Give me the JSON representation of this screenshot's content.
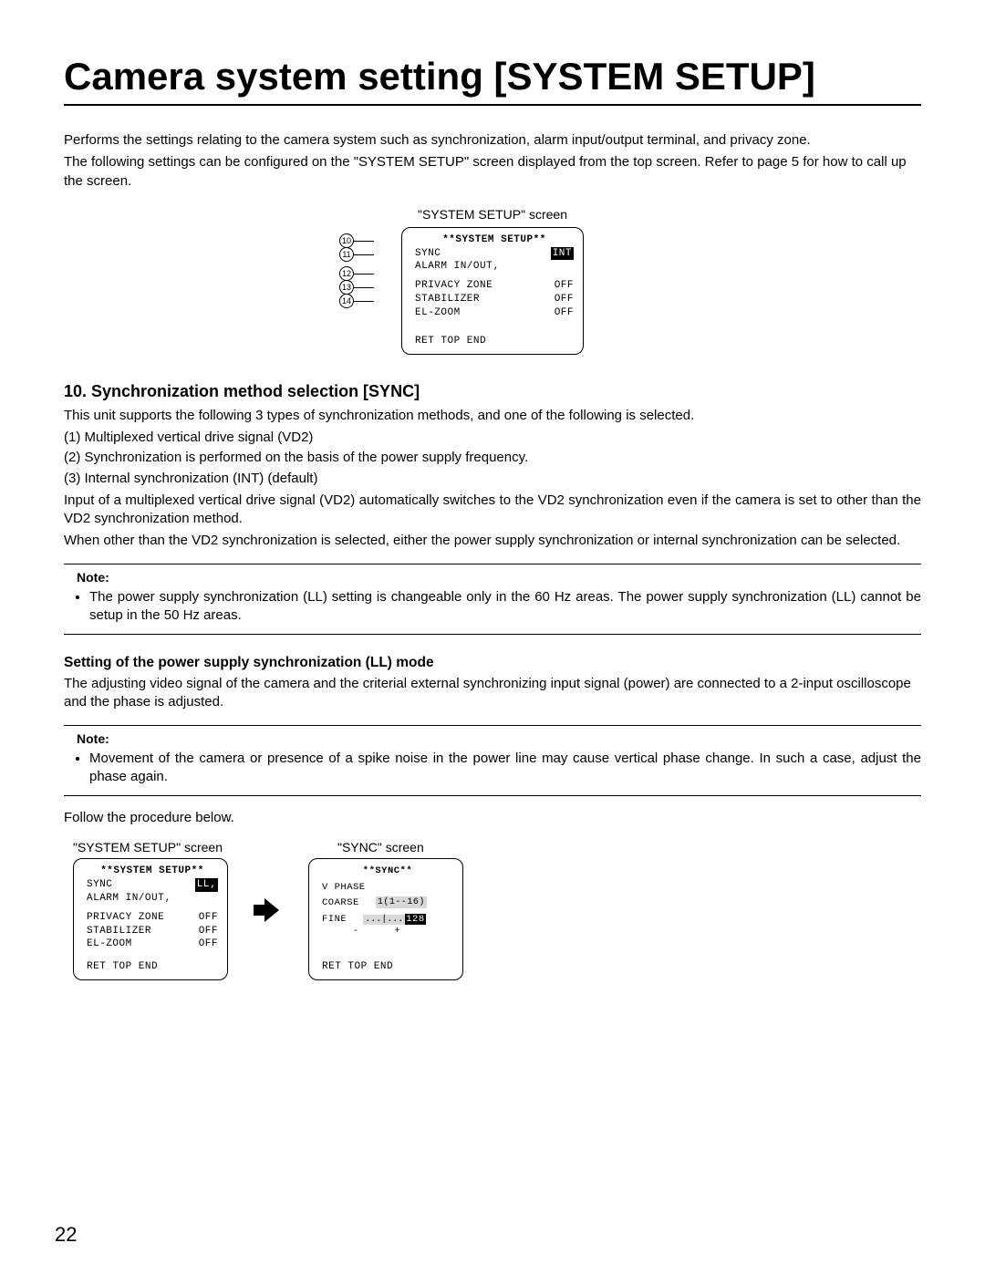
{
  "title": "Camera system setting [SYSTEM SETUP]",
  "intro": {
    "p1": "Performs the settings relating to the camera system such as synchronization, alarm input/output terminal, and privacy zone.",
    "p2": "The following settings can be configured on the \"SYSTEM SETUP\" screen displayed from the top screen. Refer to page 5 for how to call up the screen."
  },
  "fig1": {
    "label": "\"SYSTEM SETUP\" screen",
    "osd_title": "**SYSTEM SETUP**",
    "rows": [
      {
        "idx": "10",
        "label": "SYNC",
        "val": "INT",
        "inv": true
      },
      {
        "idx": "11",
        "label": "ALARM IN/OUT‚",
        "val": ""
      },
      {
        "idx": "12",
        "label": "PRIVACY ZONE",
        "val": "OFF"
      },
      {
        "idx": "13",
        "label": "STABILIZER",
        "val": "OFF"
      },
      {
        "idx": "14",
        "label": "EL-ZOOM",
        "val": "OFF"
      }
    ],
    "footer": "RET TOP END"
  },
  "section10": {
    "heading": "10. Synchronization method selection [SYNC]",
    "p1": "This unit supports the following 3 types of synchronization methods, and one of the following is selected.",
    "items": [
      "(1)  Multiplexed vertical drive signal (VD2)",
      "(2)  Synchronization is performed on the basis of the power supply frequency.",
      "(3)  Internal synchronization (INT) (default)"
    ],
    "p2": "Input of a multiplexed vertical drive signal (VD2) automatically switches to the VD2 synchronization even if the camera is set to other than the VD2 synchronization method.",
    "p3": "When other than the VD2 synchronization is selected, either the power supply synchronization or internal synchronization can be selected."
  },
  "note1": {
    "label": "Note:",
    "text": "The power supply synchronization (LL) setting is changeable only in the 60 Hz areas. The power supply synchronization (LL) cannot be setup in the 50 Hz areas."
  },
  "sub": {
    "heading": "Setting of the power supply synchronization (LL) mode",
    "p1": "The adjusting video signal of the camera and the criterial external synchronizing input signal (power) are connected to a 2-input oscilloscope and the phase is adjusted."
  },
  "note2": {
    "label": "Note:",
    "text": "Movement of the camera or presence of a spike noise in the power line may cause vertical phase change. In such a case, adjust the phase again."
  },
  "follow": "Follow the procedure below.",
  "fig2": {
    "left": {
      "label": "\"SYSTEM SETUP\" screen",
      "osd_title": "**SYSTEM SETUP**",
      "rows": [
        {
          "label": "SYNC",
          "val": "LL‚",
          "inv": true
        },
        {
          "label": "ALARM IN/OUT‚",
          "val": ""
        },
        {
          "label": "PRIVACY ZONE",
          "val": "OFF"
        },
        {
          "label": "STABILIZER",
          "val": "OFF"
        },
        {
          "label": "EL-ZOOM",
          "val": "OFF"
        }
      ],
      "footer": "RET TOP END"
    },
    "right": {
      "label": "\"SYNC\" screen",
      "osd_title": "**SYNC**",
      "vphase": "V PHASE",
      "coarse_label": "COARSE",
      "coarse_val": "1(1--16)",
      "fine_label": "FINE",
      "fine_scale": "...|...",
      "fine_num": "128",
      "signs": "-      +",
      "footer": "RET TOP END"
    }
  },
  "page_num": "22"
}
